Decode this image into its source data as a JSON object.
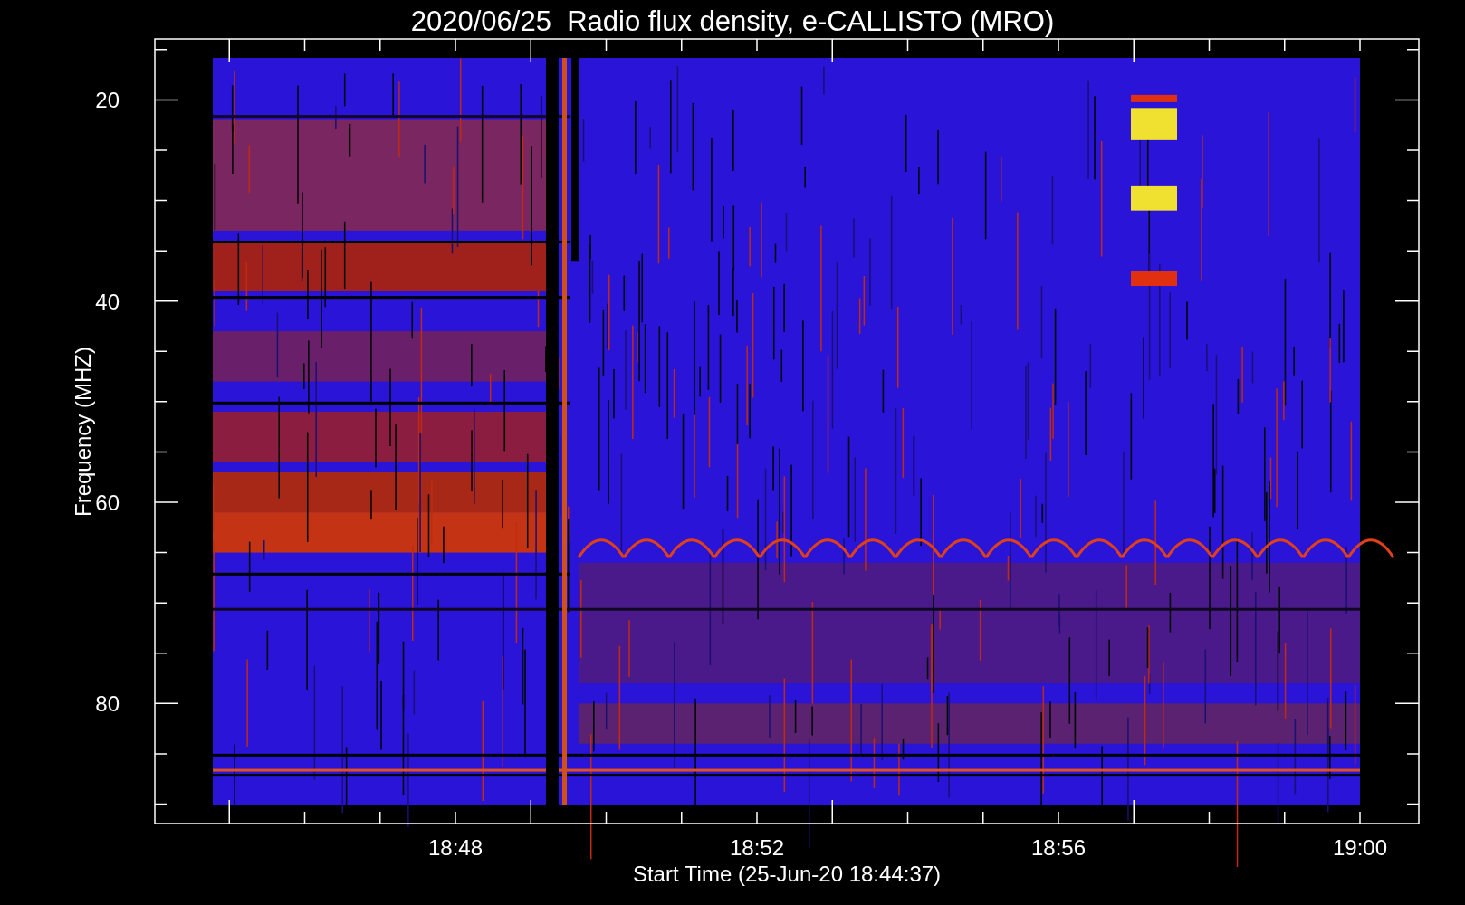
{
  "title": "2020/06/25  Radio flux density, e-CALLISTO (MRO)",
  "y_axis": {
    "label": "Frequency (MHZ)",
    "ticks": [
      "20",
      "40",
      "60",
      "80"
    ]
  },
  "x_axis": {
    "label": "Start Time (25-Jun-20 18:44:37)",
    "ticks": [
      "18:48",
      "18:52",
      "18:56",
      "19:00"
    ]
  }
}
